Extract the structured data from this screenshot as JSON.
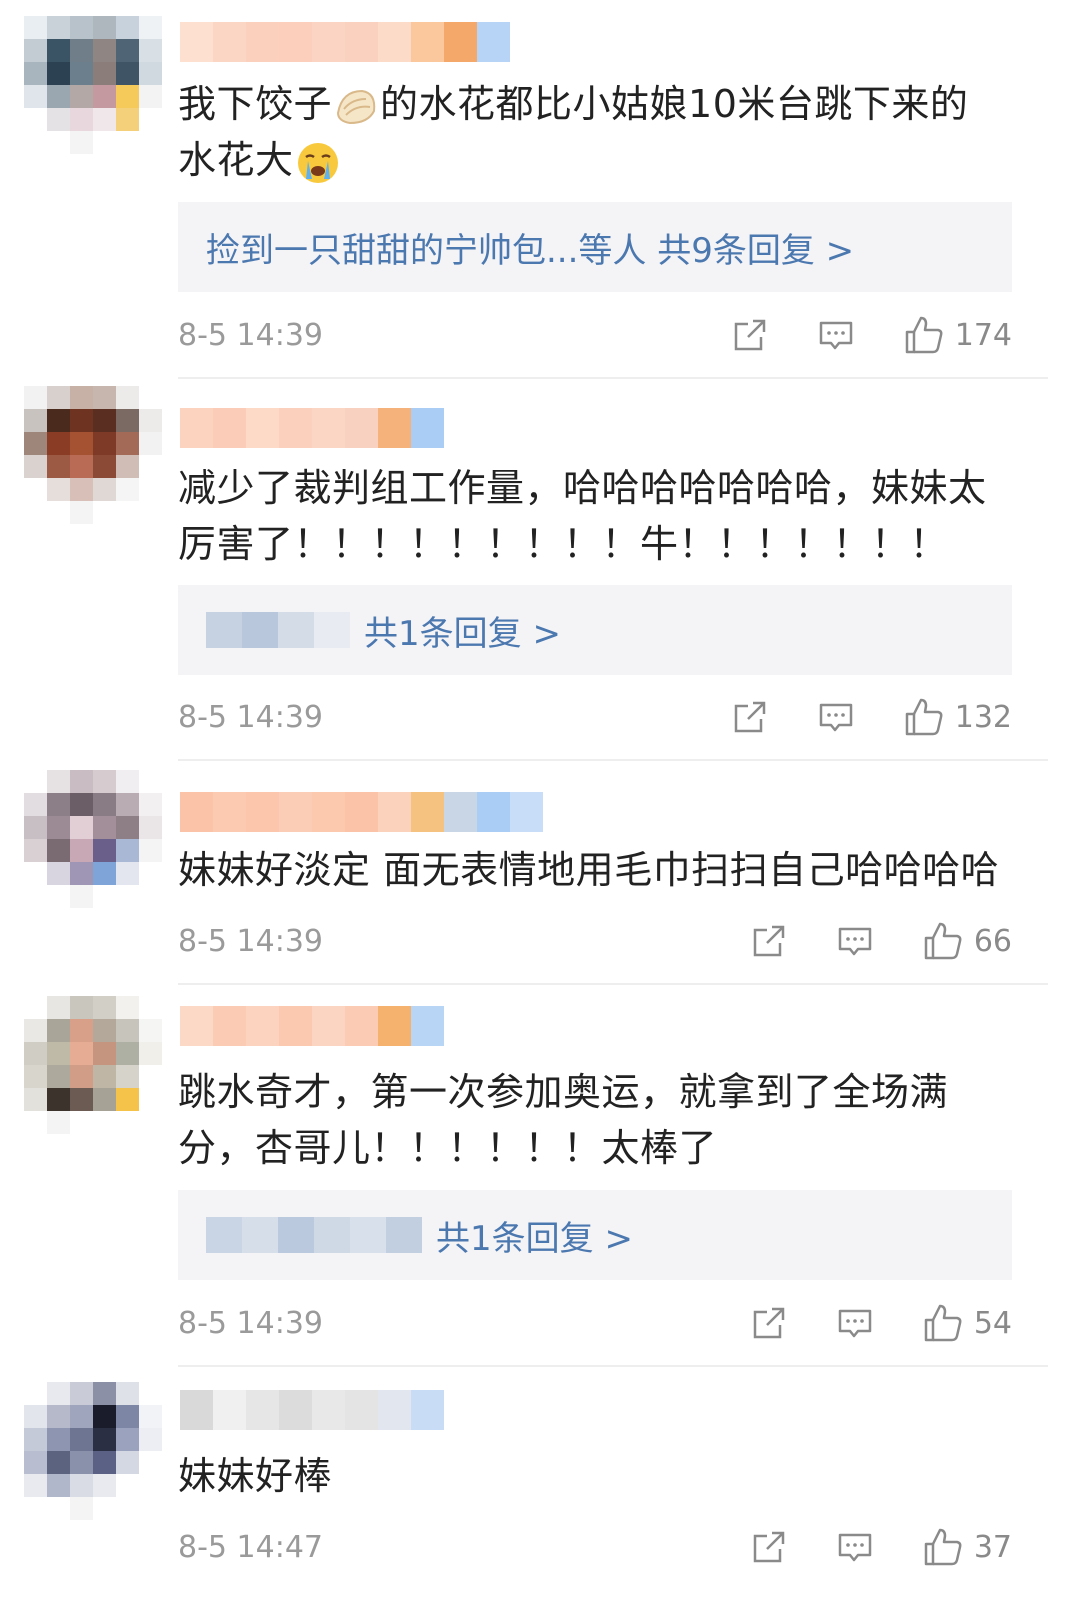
{
  "comments": [
    {
      "text_line1": "我下饺子",
      "text_line1b": "的水花都比小姑娘10米台跳下来的",
      "text_line2": "水花大",
      "reply_link": "捡到一只甜甜的宁帅包...等人 共9条回复 >",
      "time": "8-5 14:39",
      "likes": "174",
      "emoji1": "dumpling-emoji",
      "emoji2": "crying-emoji"
    },
    {
      "text_line1": "减少了裁判组工作量，哈哈哈哈哈哈哈，妹妹太",
      "text_line2": "厉害了！！！！！！！！！牛！！！！！！！",
      "reply_link": "共1条回复 >",
      "time": "8-5 14:39",
      "likes": "132"
    },
    {
      "text_line1": "妹妹好淡定 面无表情地用毛巾扫扫自己哈哈哈哈",
      "time": "8-5 14:39",
      "likes": "66"
    },
    {
      "text_line1": "跳水奇才，第一次参加奥运，就拿到了全场满",
      "text_line2": "分，杏哥儿！！！！！！太棒了",
      "reply_link": "共1条回复 >",
      "time": "8-5 14:39",
      "likes": "54"
    },
    {
      "text_line1": "妹妹好棒",
      "time": "8-5 14:47",
      "likes": "37"
    }
  ],
  "icons": {
    "share": "share-icon",
    "comment": "comment-icon",
    "like": "thumbs-up-icon"
  },
  "colors": {
    "link": "#4c78b0",
    "meta": "#9a9a9a",
    "reply_bg": "#f4f4f6"
  }
}
